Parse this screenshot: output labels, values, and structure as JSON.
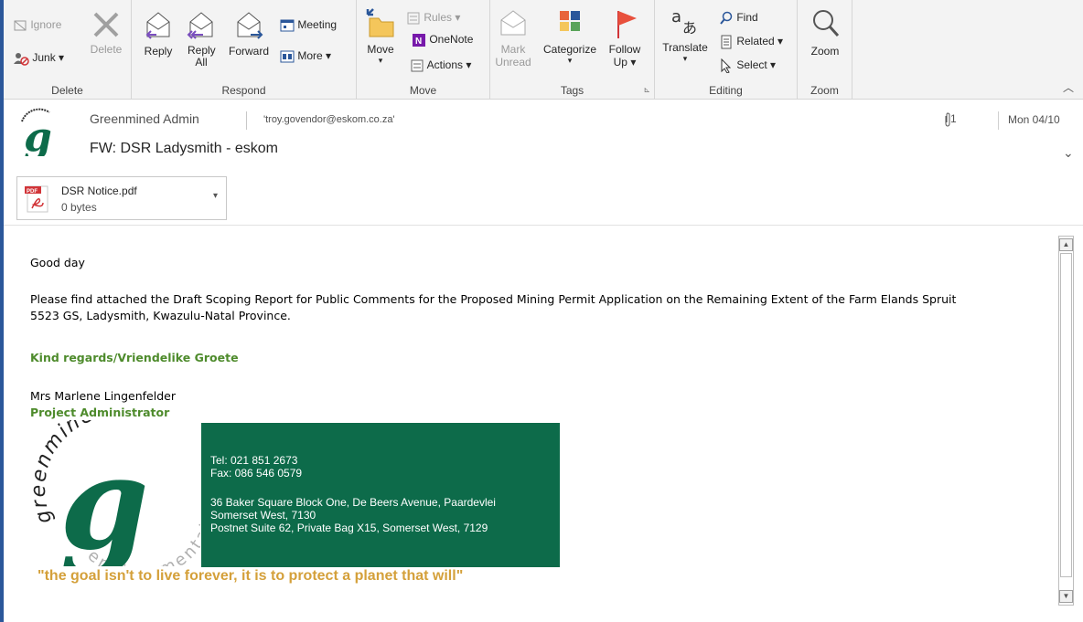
{
  "ribbon": {
    "delete_group": {
      "label": "Delete",
      "ignore": "Ignore",
      "junk": "Junk",
      "delete": "Delete"
    },
    "respond_group": {
      "label": "Respond",
      "reply": "Reply",
      "reply_all": "Reply All",
      "forward": "Forward",
      "meeting": "Meeting",
      "more": "More"
    },
    "move_group": {
      "label": "Move",
      "move": "Move",
      "rules": "Rules",
      "onenote": "OneNote",
      "actions": "Actions"
    },
    "tags_group": {
      "label": "Tags",
      "mark_unread": "Mark Unread",
      "categorize": "Categorize",
      "follow_up": "Follow Up"
    },
    "editing_group": {
      "label": "Editing",
      "translate": "Translate",
      "find": "Find",
      "related": "Related",
      "select": "Select"
    },
    "zoom_group": {
      "label": "Zoom",
      "zoom": "Zoom"
    }
  },
  "message": {
    "sender": "Greenmined Admin",
    "to": "'troy.govendor@eskom.co.za'",
    "subject": "FW: DSR Ladysmith - eskom",
    "attachment_count": "1",
    "date": "Mon 04/10"
  },
  "attachment": {
    "name": "DSR Notice.pdf",
    "size": "0 bytes",
    "type_badge": "PDF"
  },
  "body": {
    "greeting": "Good day",
    "para1_line1": "Please find attached the Draft Scoping Report for Public Comments for the Proposed Mining Permit Application on the Remaining Extent of the Farm Elands Spruit",
    "para1_line2": "5523 GS, Ladysmith, Kwazulu-Natal Province.",
    "regards": "Kind regards/Vriendelike Groete",
    "name": "Mrs Marlene Lingenfelder",
    "role": "Project Administrator"
  },
  "signature": {
    "tel": "Tel: 021 851 2673",
    "fax": "Fax: 086 546 0579",
    "addr1": "36 Baker Square Block One, De Beers Avenue, Paardevlei",
    "addr2": "Somerset West, 7130",
    "addr3": "Postnet Suite 62, Private Bag X15, Somerset West, 7129",
    "logo_text_top": "greenmined",
    "logo_text_bottom": "environmental",
    "quote": "\"the goal isn't to live forever, it is to protect a planet that will\""
  },
  "colors": {
    "accent": "#2b579a",
    "signature_bg": "#0d6b4a",
    "green_text": "#4e8b2c",
    "quote": "#d4a03a"
  }
}
